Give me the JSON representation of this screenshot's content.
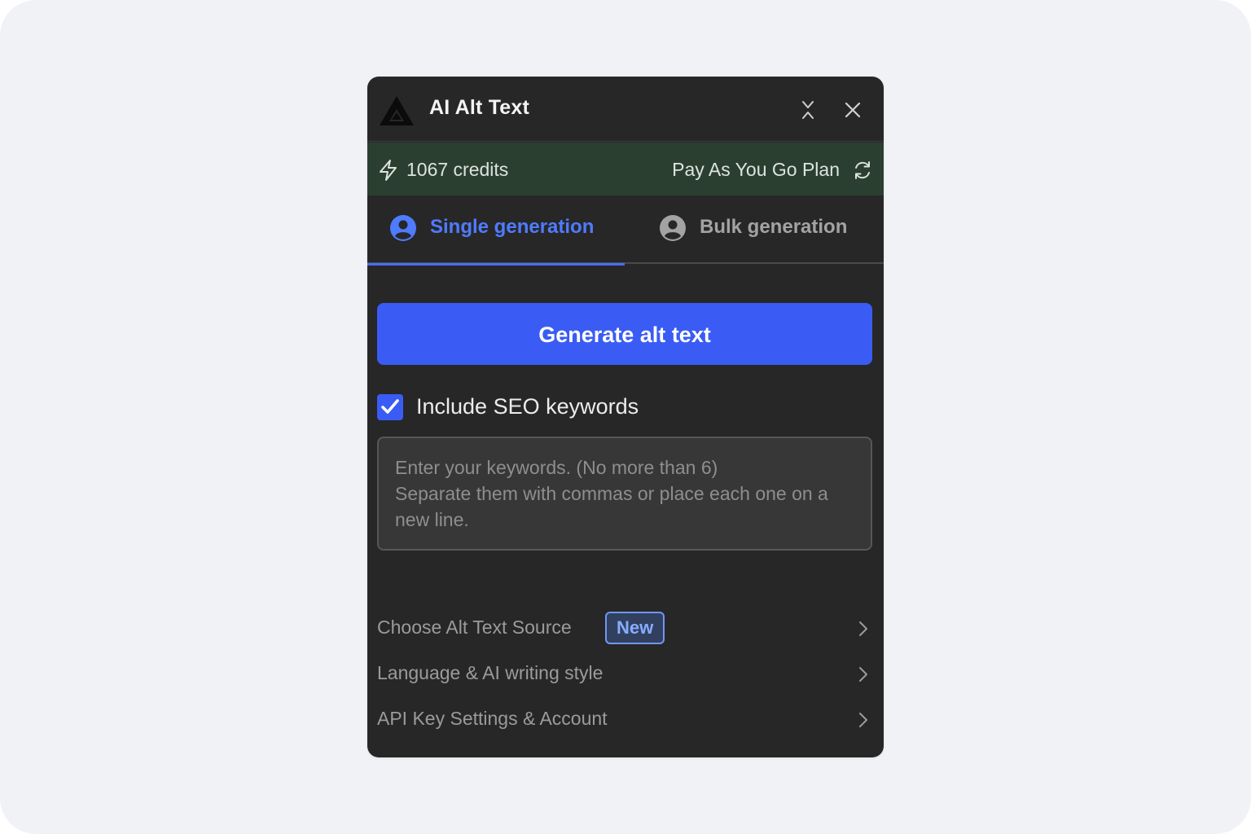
{
  "app": {
    "title": "AI Alt Text"
  },
  "icons": {
    "logo": "triangle-logo-icon",
    "collapse": "collapse-icon",
    "close": "close-icon",
    "credits": "lightning-bolt-icon",
    "refresh": "refresh-icon",
    "tab_user": "user-circle-icon",
    "chevron": "chevron-right-icon",
    "checkbox": "checkmark-icon"
  },
  "credits_bar": {
    "credits": "1067 credits",
    "plan": "Pay As You Go Plan"
  },
  "tabs": [
    {
      "label": "Single generation",
      "active": true
    },
    {
      "label": "Bulk generation",
      "active": false
    }
  ],
  "generate_button": {
    "label": "Generate alt text"
  },
  "seo": {
    "label": "Include SEO keywords",
    "checked": true,
    "placeholder": "Enter your keywords. (No more than 6)\nSeparate them with commas or place each one on a new line."
  },
  "menu": [
    {
      "label": "Choose Alt Text Source",
      "badge": "New"
    },
    {
      "label": "Language & AI writing style"
    },
    {
      "label": "API Key Settings & Account"
    }
  ],
  "colors": {
    "panel_bg": "#272727",
    "credits_bar_bg": "#2b3f31",
    "accent": "#3a5cf5",
    "active_tab": "#4f7bff",
    "page_bg": "#f1f2f6"
  }
}
